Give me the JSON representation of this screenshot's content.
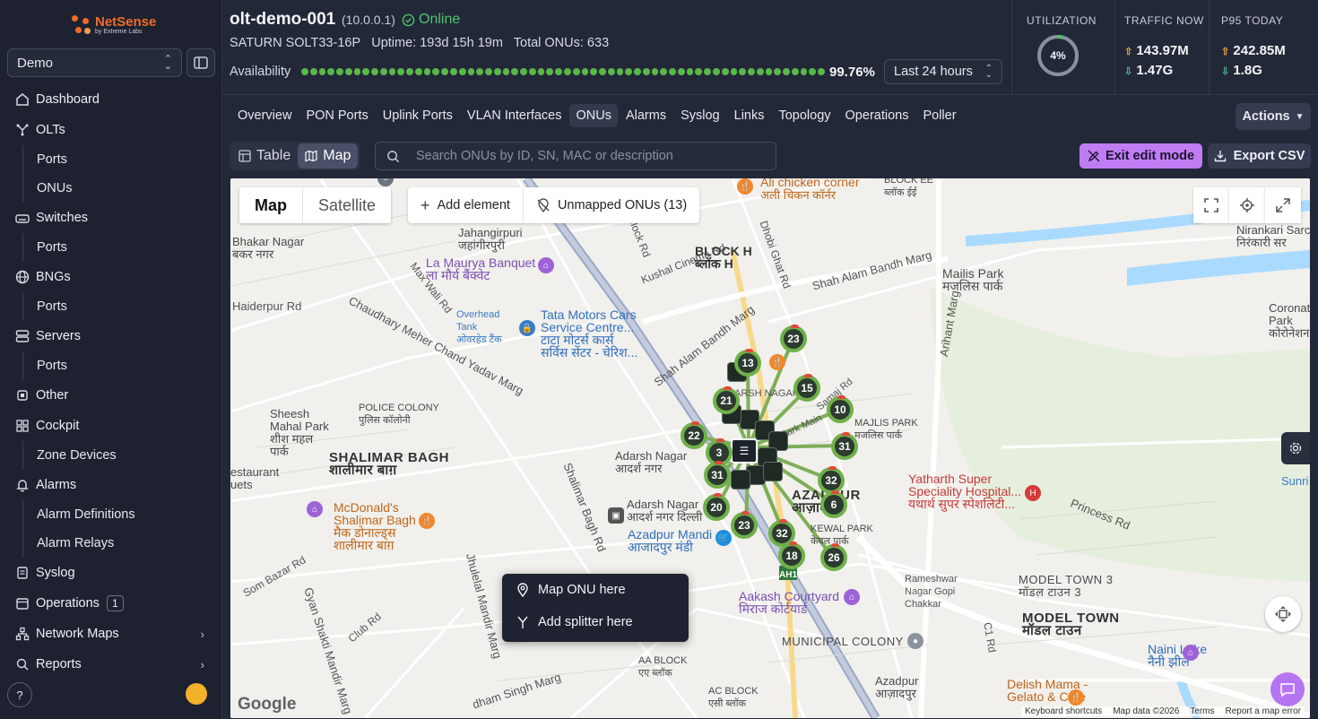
{
  "brand": {
    "name": "NetSense",
    "tagline": "by Extreme Labs",
    "color": "#f06a2a"
  },
  "org_select": {
    "value": "Demo"
  },
  "sidebar": {
    "items": [
      {
        "label": "Dashboard",
        "icon": "home-icon"
      },
      {
        "label": "OLTs",
        "icon": "olt-icon"
      },
      {
        "label": "Ports",
        "sub": true
      },
      {
        "label": "ONUs",
        "sub": true
      },
      {
        "label": "Switches",
        "icon": "switch-icon"
      },
      {
        "label": "Ports",
        "sub": true
      },
      {
        "label": "BNGs",
        "icon": "globe-icon"
      },
      {
        "label": "Ports",
        "sub": true
      },
      {
        "label": "Servers",
        "icon": "server-icon"
      },
      {
        "label": "Ports",
        "sub": true
      },
      {
        "label": "Other",
        "icon": "chip-icon"
      },
      {
        "label": "Cockpit",
        "icon": "grid-icon"
      },
      {
        "label": "Zone Devices",
        "sub": true
      },
      {
        "label": "Alarms",
        "icon": "bell-icon"
      },
      {
        "label": "Alarm Definitions",
        "sub": true
      },
      {
        "label": "Alarm Relays",
        "sub": true
      },
      {
        "label": "Syslog",
        "icon": "log-icon"
      },
      {
        "label": "Operations",
        "icon": "calendar-icon",
        "badge": "1"
      },
      {
        "label": "Network Maps",
        "icon": "network-icon",
        "chevron": true
      },
      {
        "label": "Reports",
        "icon": "search-icon",
        "chevron": true
      }
    ],
    "help": "?"
  },
  "header": {
    "title": "olt-demo-001",
    "ip": "(10.0.0.1)",
    "status": "Online",
    "model": "SATURN SOLT33-16P",
    "uptime": "Uptime: 193d 15h 19m",
    "total_onus": "Total ONUs: 633",
    "availability_label": "Availability",
    "availability_pct": "99.76%",
    "range": "Last 24 hours",
    "utilization_label": "UTILIZATION",
    "utilization_value": "4%",
    "utilization_fraction": 0.04,
    "traffic_label": "TRAFFIC NOW",
    "traffic_up": "143.97M",
    "traffic_down": "1.47G",
    "p95_label": "P95 TODAY",
    "p95_up": "242.85M",
    "p95_down": "1.8G"
  },
  "tabs": [
    {
      "label": "Overview"
    },
    {
      "label": "PON Ports"
    },
    {
      "label": "Uplink Ports"
    },
    {
      "label": "VLAN Interfaces"
    },
    {
      "label": "ONUs",
      "active": true
    },
    {
      "label": "Alarms"
    },
    {
      "label": "Syslog"
    },
    {
      "label": "Links"
    },
    {
      "label": "Topology"
    },
    {
      "label": "Operations"
    },
    {
      "label": "Poller"
    }
  ],
  "actions_label": "Actions",
  "toolbar": {
    "table_label": "Table",
    "map_label": "Map",
    "search_placeholder": "Search ONUs by ID, SN, MAC or description",
    "exit_edit_label": "Exit edit mode",
    "export_label": "Export CSV"
  },
  "map": {
    "type_map": "Map",
    "type_satellite": "Satellite",
    "add_element": "Add element",
    "unmapped": "Unmapped ONUs (13)",
    "context_menu": [
      "Map ONU here",
      "Add splitter here"
    ],
    "google": "Google",
    "footer": [
      "Keyboard shortcuts",
      "Map data ©2026",
      "Terms",
      "Report a map error"
    ],
    "clusters": [
      "23",
      "13",
      "15",
      "21",
      "10",
      "22",
      "31",
      "3",
      "31",
      "32",
      "6",
      "20",
      "23",
      "32",
      "18",
      "26"
    ],
    "places": {
      "ali": "Ali chicken corner",
      "ali_hi": "अली चिकन कॉर्नर",
      "block_ee": "BLOCK EE",
      "block_ee_hi": "ब्लॉक ईई",
      "jahangirpuri": "Jahangirpuri",
      "jahangirpuri_hi": "जहांगीरपुरी",
      "bhakar": "Bhakar Nagar",
      "bhakar_hi": "बकर नगर",
      "maurya": "La Maurya Banquet",
      "maurya_hi": "ला मौर्य बैंक्वेट",
      "block_h": "BLOCK H",
      "block_h_hi": "ब्लॉक H",
      "mailis": "Mailis Park",
      "mailis_hi": "मजलिस पार्क",
      "nirankari": "Nirankari Sarc",
      "nirankari_hi": "निरंकारी सर",
      "tata1": "Tata Motors Cars",
      "tata2": "Service Centre...",
      "tata_hi1": "टाटा मोटर्स कार्स",
      "tata_hi2": "सर्विस सेंटर - चेरिश...",
      "overhead1": "Overhead",
      "overhead2": "Tank",
      "overhead_hi": "ओवरहेड टैंक",
      "coronation1": "Coronation",
      "coronation2": "Park",
      "coronation_hi": "कोरोनेशन पार्क",
      "sheesh1": "Sheesh",
      "sheesh2": "Mahal Park",
      "sheesh_hi1": "शीश महल",
      "sheesh_hi2": "पार्क",
      "police": "POLICE COLONY",
      "police_hi": "पुलिस कॉलोनी",
      "majlis": "MAJLIS PARK",
      "majlis_hi": "मजलिस पार्क",
      "shalimar": "SHALIMAR BAGH",
      "shalimar_hi": "शालीमार बाग़",
      "adarsh1": "Adarsh Nagar",
      "adarsh1_hi": "आदर्श नगर",
      "azadpur": "AZADPUR",
      "azadpur_hi": "आज़ादपुर",
      "yatharth1": "Yatharth Super",
      "yatharth2": "Speciality Hospital...",
      "yatharth_hi": "यथार्थ सुपर स्पेशलिटी...",
      "restaurant1": "estaurant",
      "restaurant2": "uets",
      "sunri": "Sunri",
      "mcd1": "McDonald's",
      "mcd2": "Shalimar Bagh",
      "mcd_hi1": "मैक डोनाल्ड्स",
      "mcd_hi2": "शालीमार बाग़",
      "adarsh2": "Adarsh Nagar",
      "adarsh2_hi": "आदर्श नगर दिल्ली",
      "mandi": "Azadpur Mandi",
      "mandi_hi": "आजादपुर मंडी",
      "kewal": "KEWAL PARK",
      "kewal_hi": "केवल पार्क",
      "model3": "MODEL TOWN 3",
      "model3_hi": "मॉडल टाउन 3",
      "model": "MODEL TOWN",
      "model_hi": "मॉडल टाउन",
      "aakash": "Aakash Courtyard",
      "aakash_hi": "मिराज कोर्टयार्ड",
      "rameshwar1": "Rameshwar",
      "rameshwar2": "Nagar Gopi",
      "rameshwar3": "Chakkar",
      "municipal": "MUNICIPAL COLONY",
      "naini": "Naini Lake",
      "naini_hi": "नैनी झील",
      "aa_block": "AA BLOCK",
      "aa_block_hi": "एए ब्लॉक",
      "ac_block": "AC BLOCK",
      "ac_block_hi": "एसी ब्लॉक",
      "azadpur2": "Azadpur",
      "azadpur2_hi": "आज़ादपुर",
      "delish1": "Delish Mama -",
      "delish2": "Gelato & Cafe",
      "ah1": "AH1",
      "r_max": "Max Wali Rd",
      "r_kushal": "Kushal Cinema Rd",
      "r_block": "Block Rd",
      "r_dhobi": "Dhobi Ghat Rd",
      "r_shah1": "Shah Alam Bandh Marg",
      "r_shah2": "Shah Alam Bandh Marg",
      "r_haiderpur": "Haiderpur Rd",
      "r_chaudhary": "Chaudhary Meher Chand Yadav Marg",
      "r_arihant": "Arihant Marg",
      "r_princess": "Princess Rd",
      "r_shalimar": "Shalimar Bagh Rd",
      "r_jhulelal": "Jhulelal Mandir Marg",
      "r_gyan": "Gyan Shakti Mandir Marg",
      "r_som": "Som Bazar Rd",
      "r_club": "Club Rd",
      "r_c1": "C1 Rd",
      "r_pradham": "dham Singh Marg",
      "r_park": "Park Main",
      "r_samaj": "Samaj Rd",
      "r_marsh": "ARSH NAGAR"
    }
  }
}
